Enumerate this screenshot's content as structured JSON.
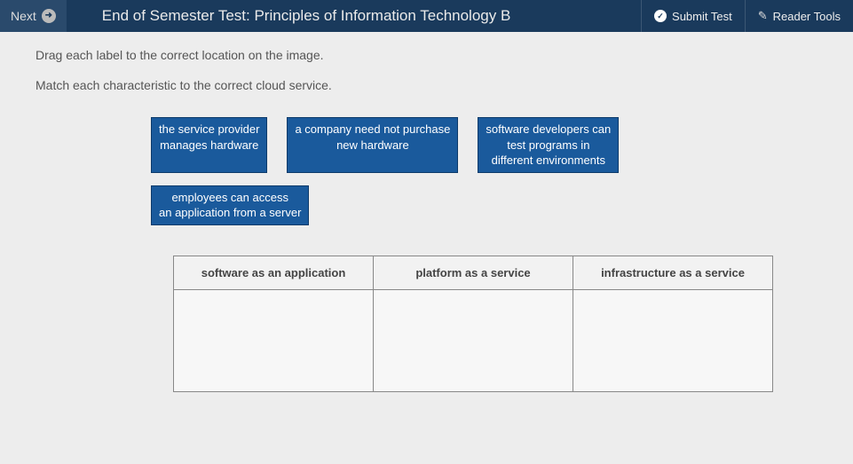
{
  "topbar": {
    "next_label": "Next",
    "title": "End of Semester Test: Principles of Information Technology B",
    "submit_label": "Submit Test",
    "tools_label": "Reader Tools"
  },
  "instructions": {
    "line1": "Drag each label to the correct location on the image.",
    "line2": "Match each characteristic to the correct cloud service."
  },
  "labels": [
    "the service provider\nmanages hardware",
    "a company need not purchase\nnew hardware",
    "software developers can\ntest programs in\ndifferent environments",
    "employees can access\nan application from a server"
  ],
  "columns": [
    "software as an application",
    "platform as a service",
    "infrastructure as a service"
  ]
}
